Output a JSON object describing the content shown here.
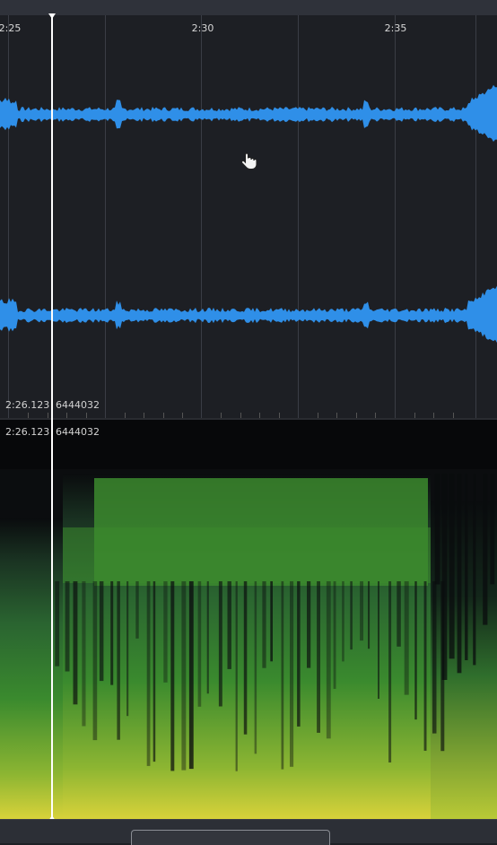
{
  "timeline": {
    "ticks": [
      {
        "label": "2:25"
      },
      {
        "label": "2:30"
      },
      {
        "label": "2:35"
      }
    ]
  },
  "waveform": {
    "time_readout": "2:26.123",
    "sample_readout": "6444032",
    "color": "#2f8fe8"
  },
  "spectrogram": {
    "time_readout": "2:26.123",
    "sample_readout": "6444032",
    "colors": {
      "low": "#0a0c0e",
      "mid": "#2f7d3a",
      "high": "#c8d838"
    }
  },
  "cursor": {
    "icon": "hand-pointer-icon"
  },
  "scrollbar": {
    "label": ""
  }
}
